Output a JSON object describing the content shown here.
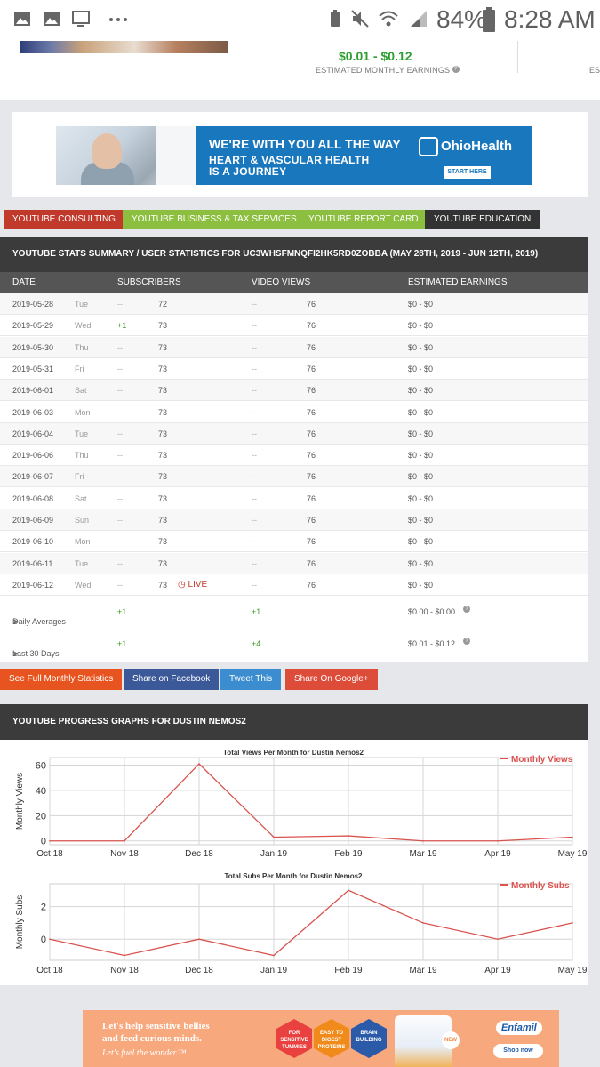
{
  "status_bar": {
    "battery": "84%",
    "time": "8:28 AM",
    "icons": [
      "image-icon",
      "image-icon",
      "tv-icon",
      "more-icon",
      "battery-saver-icon",
      "mute-icon",
      "wifi-icon",
      "signal-icon",
      "battery-icon"
    ]
  },
  "header": {
    "earnings_range": "$0.01 - $0.12",
    "earnings_label": "ESTIMATED MONTHLY EARNINGS",
    "earnings_label_cut": "ES"
  },
  "ad_top": {
    "line1": "WE'RE WITH YOU ALL THE WAY",
    "line2": "HEART & VASCULAR HEALTH",
    "line3": "IS A JOURNEY",
    "brand": "OhioHealth",
    "cta": "START HERE"
  },
  "categories": [
    {
      "label": "YOUTUBE CONSULTING",
      "color": "#c0392b"
    },
    {
      "label": "YOUTUBE BUSINESS & TAX SERVICES",
      "color": "#8cbf3f"
    },
    {
      "label": "YOUTUBE REPORT CARD",
      "color": "#8cbf3f"
    },
    {
      "label": "YOUTUBE EDUCATION",
      "color": "#333333"
    }
  ],
  "stats": {
    "title": "YOUTUBE STATS SUMMARY / USER STATISTICS FOR UC3WHSFMNQFI2HK5RD0ZOBBA (MAY 28TH, 2019 - JUN 12TH, 2019)",
    "columns": [
      "DATE",
      "SUBSCRIBERS",
      "VIDEO VIEWS",
      "ESTIMATED EARNINGS"
    ],
    "rows": [
      {
        "date": "2019-05-28",
        "day": "Tue",
        "sub_change": "--",
        "subs": "72",
        "view_change": "--",
        "views": "76",
        "earn": "$0  -  $0"
      },
      {
        "date": "2019-05-29",
        "day": "Wed",
        "sub_change": "+1",
        "subs": "73",
        "view_change": "--",
        "views": "76",
        "earn": "$0  -  $0"
      },
      {
        "date": "2019-05-30",
        "day": "Thu",
        "sub_change": "--",
        "subs": "73",
        "view_change": "--",
        "views": "76",
        "earn": "$0  -  $0"
      },
      {
        "date": "2019-05-31",
        "day": "Fri",
        "sub_change": "--",
        "subs": "73",
        "view_change": "--",
        "views": "76",
        "earn": "$0  -  $0"
      },
      {
        "date": "2019-06-01",
        "day": "Sat",
        "sub_change": "--",
        "subs": "73",
        "view_change": "--",
        "views": "76",
        "earn": "$0  -  $0"
      },
      {
        "date": "2019-06-03",
        "day": "Mon",
        "sub_change": "--",
        "subs": "73",
        "view_change": "--",
        "views": "76",
        "earn": "$0  -  $0"
      },
      {
        "date": "2019-06-04",
        "day": "Tue",
        "sub_change": "--",
        "subs": "73",
        "view_change": "--",
        "views": "76",
        "earn": "$0  -  $0"
      },
      {
        "date": "2019-06-06",
        "day": "Thu",
        "sub_change": "--",
        "subs": "73",
        "view_change": "--",
        "views": "76",
        "earn": "$0  -  $0"
      },
      {
        "date": "2019-06-07",
        "day": "Fri",
        "sub_change": "--",
        "subs": "73",
        "view_change": "--",
        "views": "76",
        "earn": "$0  -  $0"
      },
      {
        "date": "2019-06-08",
        "day": "Sat",
        "sub_change": "--",
        "subs": "73",
        "view_change": "--",
        "views": "76",
        "earn": "$0  -  $0"
      },
      {
        "date": "2019-06-09",
        "day": "Sun",
        "sub_change": "--",
        "subs": "73",
        "view_change": "--",
        "views": "76",
        "earn": "$0  -  $0"
      },
      {
        "date": "2019-06-10",
        "day": "Mon",
        "sub_change": "--",
        "subs": "73",
        "view_change": "--",
        "views": "76",
        "earn": "$0  -  $0"
      },
      {
        "date": "2019-06-11",
        "day": "Tue",
        "sub_change": "--",
        "subs": "73",
        "view_change": "--",
        "views": "76",
        "earn": "$0  -  $0"
      },
      {
        "date": "2019-06-12",
        "day": "Wed",
        "sub_change": "--",
        "subs": "73",
        "view_change": "--",
        "views": "76",
        "earn": "$0  -  $0",
        "live": "LIVE"
      }
    ],
    "daily_avg": {
      "label": "Daily Averages",
      "subs": "+1",
      "views": "+1",
      "earn": "$0.00  -  $0.00"
    },
    "last30": {
      "label": "Last 30 Days",
      "subs": "+1",
      "views": "+4",
      "earn": "$0.01  -  $0.12"
    }
  },
  "share_buttons": [
    {
      "label": "See Full Monthly Statistics",
      "color": "#e8541f"
    },
    {
      "label": "Share on Facebook",
      "color": "#3b5998"
    },
    {
      "label": "Tweet This",
      "color": "#3b8dd0"
    },
    {
      "label": "Share On Google+",
      "color": "#dd4b39"
    }
  ],
  "graphs_title": "YOUTUBE PROGRESS GRAPHS FOR DUSTIN NEMOS2",
  "chart_data": [
    {
      "type": "line",
      "title": "Total Views Per Month for Dustin Nemos2",
      "ylabel": "Monthly Views",
      "x": [
        "Oct 18",
        "Nov 18",
        "Dec 18",
        "Jan 19",
        "Feb 19",
        "Mar 19",
        "Apr 19",
        "May 19"
      ],
      "y_ticks": [
        0,
        20,
        40,
        60
      ],
      "ylim": [
        -3,
        66
      ],
      "series": [
        {
          "name": "Monthly Views",
          "color": "#d9534f",
          "values": [
            0,
            0,
            61,
            3,
            4,
            0,
            0,
            3
          ]
        }
      ],
      "grid": true,
      "legend": "top-right"
    },
    {
      "type": "line",
      "title": "Total Subs Per Month for Dustin Nemos2",
      "ylabel": "Monthly Subs",
      "x": [
        "Oct 18",
        "Nov 18",
        "Dec 18",
        "Jan 19",
        "Feb 19",
        "Mar 19",
        "Apr 19",
        "May 19"
      ],
      "y_ticks": [
        0,
        2
      ],
      "ylim": [
        -1.3,
        3.4
      ],
      "series": [
        {
          "name": "Monthly Subs",
          "color": "#d9534f",
          "values": [
            0,
            -1,
            0,
            -1,
            3,
            1,
            0,
            1
          ]
        }
      ],
      "grid": true,
      "legend": "top-right"
    }
  ],
  "ad_bottom": {
    "line1": "Let's help sensitive bellies",
    "line2": "and feed curious minds.",
    "line3": "Let's fuel the wonder.™",
    "hex1": "FOR SENSITIVE TUMMIES",
    "hex2": "EASY TO DIGEST PROTEINS",
    "hex3": "BRAIN BUILDING",
    "new_badge": "NEW",
    "brand": "Enfamil",
    "cta": "Shop now"
  }
}
